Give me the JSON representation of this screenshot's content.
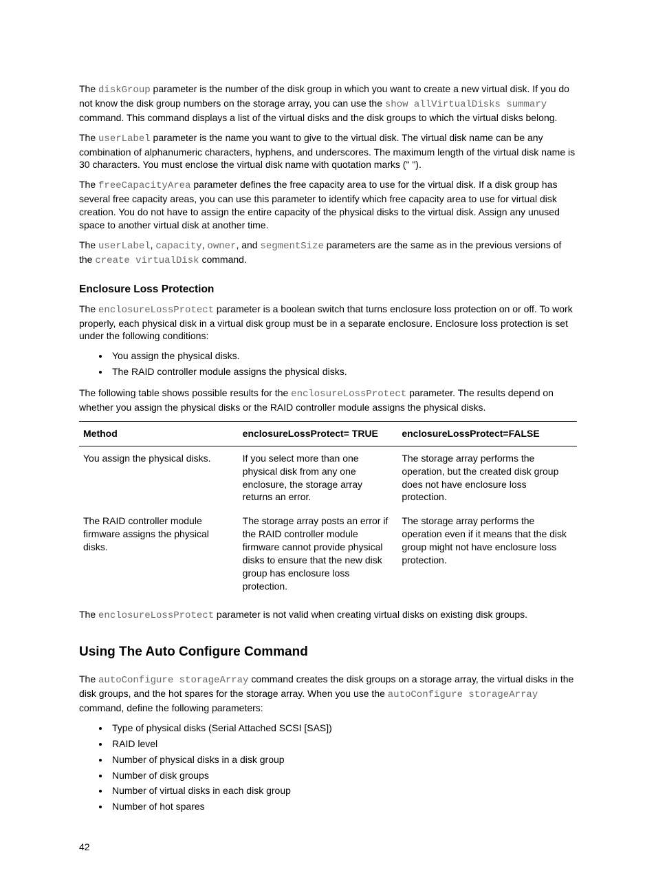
{
  "p1": {
    "a": "The ",
    "code1": "diskGroup",
    "b": " parameter is the number of the disk group in which you want to create a new virtual disk. If you do not know the disk group numbers on the storage array, you can use the ",
    "code2": "show allVirtualDisks summary",
    "c": " command. This command displays a list of the virtual disks and the disk groups to which the virtual disks belong."
  },
  "p2": {
    "a": "The ",
    "code1": "userLabel",
    "b": " parameter is the name you want to give to the virtual disk. The virtual disk name can be any combination of alphanumeric characters, hyphens, and underscores. The maximum length of the virtual disk name is 30 characters. You must enclose the virtual disk name with quotation marks (\" \")."
  },
  "p3": {
    "a": "The ",
    "code1": "freeCapacityArea",
    "b": " parameter defines the free capacity area to use for the virtual disk. If a disk group has several free capacity areas, you can use this parameter to identify which free capacity area to use for virtual disk creation. You do not have to assign the entire capacity of the physical disks to the virtual disk. Assign any unused space to another virtual disk at another time."
  },
  "p4": {
    "a": "The ",
    "code1": "userLabel",
    "b": ", ",
    "code2": "capacity",
    "c": ", ",
    "code3": "owner",
    "d": ", and ",
    "code4": "segmentSize",
    "e": " parameters are the same as in the previous versions of the ",
    "code5": "create virtualDisk",
    "f": " command."
  },
  "h3_1": "Enclosure Loss Protection",
  "p5": {
    "a": "The ",
    "code1": "enclosureLossProtect",
    "b": " parameter is a boolean switch that turns enclosure loss protection on or off. To work properly, each physical disk in a virtual disk group must be in a separate enclosure. Enclosure loss protection is set under the following conditions:"
  },
  "list1": {
    "i0": "You assign the physical disks.",
    "i1": "The RAID controller module assigns the physical disks."
  },
  "p6": {
    "a": "The following table shows possible results for the ",
    "code1": "enclosureLossProtect",
    "b": " parameter. The results depend on whether you assign the physical disks or the RAID controller module assigns the physical disks."
  },
  "table": {
    "h0": "Method",
    "h1": "enclosureLossProtect= TRUE",
    "h2": "enclosureLossProtect=FALSE",
    "r0": {
      "c0": "You assign the physical disks.",
      "c1": "If you select more than one physical disk from any one enclosure, the storage array returns an error.",
      "c2": "The storage array performs the operation, but the created disk group does not have enclosure loss protection."
    },
    "r1": {
      "c0": "The RAID controller module firmware assigns the physical disks.",
      "c1": "The storage array posts an error if the RAID controller module firmware cannot provide physical disks to ensure that the new disk group has enclosure loss protection.",
      "c2": "The storage array performs the operation even if it means that the disk group might not have enclosure loss protection."
    }
  },
  "p7": {
    "a": "The ",
    "code1": "enclosureLossProtect",
    "b": " parameter is not valid when creating virtual disks on existing disk groups."
  },
  "h2_1": "Using The Auto Configure Command",
  "p8": {
    "a": "The ",
    "code1": "autoConfigure storageArray",
    "b": " command creates the disk groups on a storage array, the virtual disks in the disk groups, and the hot spares for the storage array. When you use the ",
    "code2": "autoConfigure storageArray",
    "c": " command, define the following parameters:"
  },
  "list2": {
    "i0": "Type of physical disks (Serial Attached SCSI [SAS])",
    "i1": "RAID level",
    "i2": "Number of physical disks in a disk group",
    "i3": "Number of disk groups",
    "i4": "Number of virtual disks in each disk group",
    "i5": "Number of hot spares"
  },
  "pagenum": "42"
}
